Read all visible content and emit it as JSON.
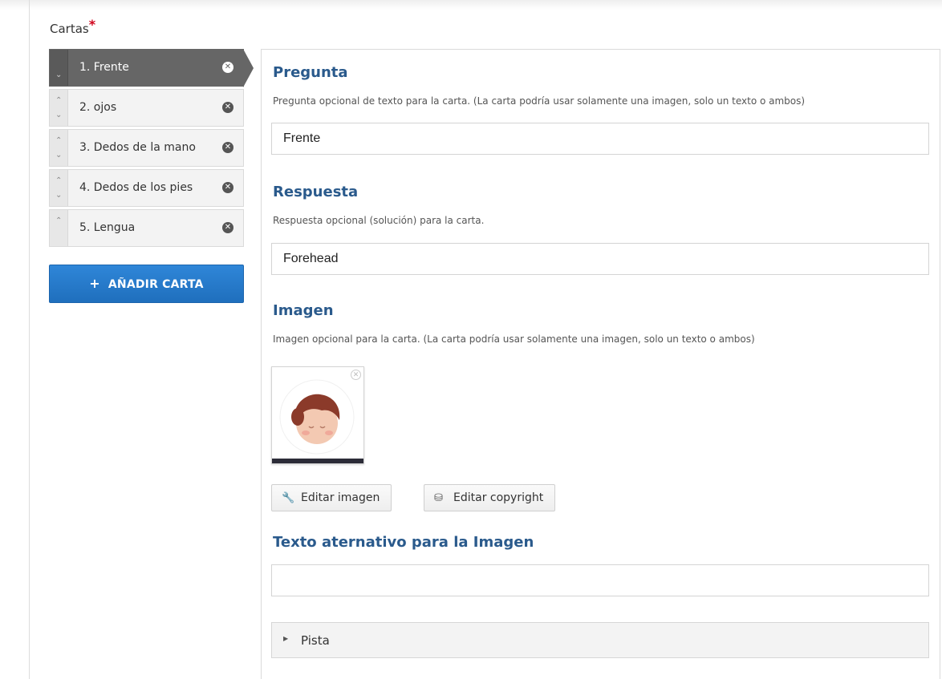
{
  "field": {
    "label": "Cartas",
    "required_mark": "*"
  },
  "cards": [
    {
      "label": "1. Frente",
      "up": "",
      "down": "⌄",
      "remove": "✕"
    },
    {
      "label": "2. ojos",
      "up": "⌃",
      "down": "⌄",
      "remove": "✕"
    },
    {
      "label": "3. Dedos de la mano",
      "up": "⌃",
      "down": "⌄",
      "remove": "✕"
    },
    {
      "label": "4. Dedos de los pies",
      "up": "⌃",
      "down": "⌄",
      "remove": "✕"
    },
    {
      "label": "5. Lengua",
      "up": "⌃",
      "down": "",
      "remove": "✕"
    }
  ],
  "add_button": {
    "icon": "+",
    "label": "AÑADIR CARTA"
  },
  "question": {
    "title": "Pregunta",
    "description": "Pregunta opcional de texto para la carta. (La carta podría usar solamente una imagen, solo un texto o ambos)",
    "value": "Frente"
  },
  "answer": {
    "title": "Respuesta",
    "description": "Respuesta opcional (solución) para la carta.",
    "value": "Forehead"
  },
  "image": {
    "title": "Imagen",
    "description": "Imagen opcional para la carta. (La carta podría usar solamente una imagen, solo un texto o ambos)",
    "remove_glyph": "✕",
    "edit_image_label": "Editar imagen",
    "edit_copyright_label": "Editar copyright",
    "wrench_glyph": "🔧",
    "copyright_glyph": "⛁"
  },
  "alt_text": {
    "title": "Texto aternativo para la Imagen",
    "value": ""
  },
  "hint": {
    "arrow": "▶",
    "label": "Pista"
  },
  "colors": {
    "accent": "#2a5a8c",
    "button": "#2478c8",
    "active_card": "#666666"
  }
}
